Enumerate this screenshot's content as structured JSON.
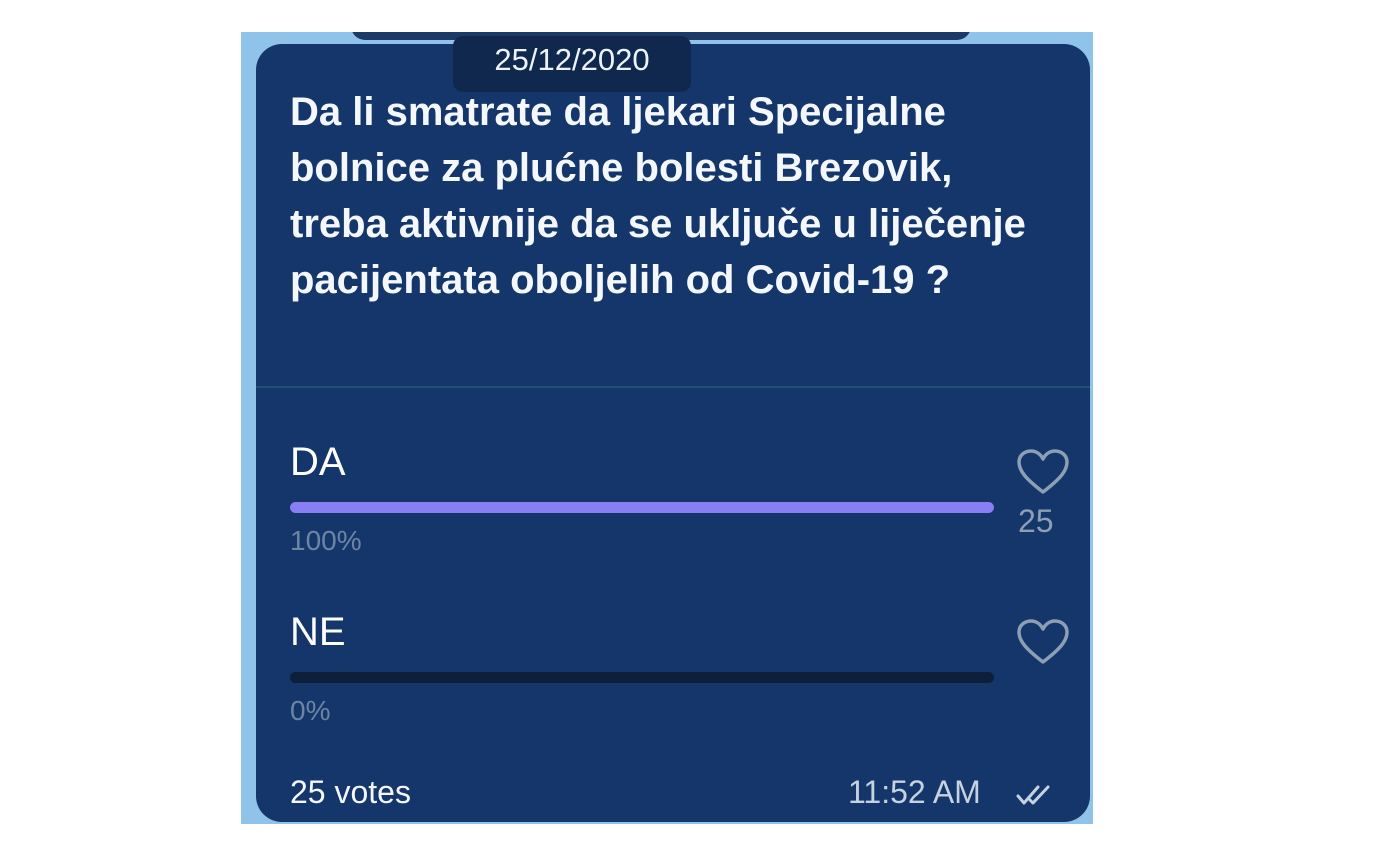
{
  "poll": {
    "date": "25/12/2020",
    "question": "Da li smatrate da ljekari  Specijalne bolnice za plućne bolesti Brezovik, treba aktivnije da se uključe u liječenje pacijentata oboljelih od Covid-19 ?",
    "options": [
      {
        "label": "DA",
        "percent_text": "100%",
        "fraction": 1.0,
        "votes": "25",
        "bar_color": "#8a7ef5"
      },
      {
        "label": "NE",
        "percent_text": "0%",
        "fraction": 0.0,
        "votes": "",
        "bar_color": "#8a7ef5"
      }
    ],
    "total_votes": "25 votes",
    "time": "11:52 AM",
    "status_icon": "double-check-icon",
    "option_icon": "heart-icon"
  },
  "colors": {
    "chat_background": "#8fc3ea",
    "bubble": "#14366a",
    "text": "#f4f7fb",
    "accent": "#8a7ef5"
  }
}
